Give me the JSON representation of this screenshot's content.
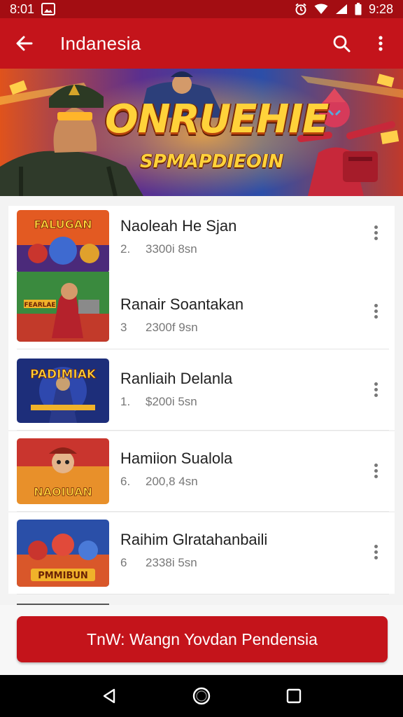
{
  "status_bar": {
    "left_time": "8:01",
    "right_time": "9:28",
    "icons": [
      "gallery-icon",
      "alarm-icon",
      "wifi-icon",
      "signal-icon",
      "battery-icon"
    ]
  },
  "app_bar": {
    "title": "Indanesia",
    "back_icon": "arrow-left-icon",
    "search_icon": "search-icon",
    "more_icon": "more-vertical-icon"
  },
  "banner": {
    "title": "ONRUEHIE",
    "subtitle": "SPMAPDIEOIN"
  },
  "list": {
    "items": [
      {
        "title": "Naoleah He Sjan",
        "number": "2.",
        "meta": "3300i 8sn",
        "thumb_text": "FALUGAN"
      },
      {
        "title": "Ranair Soantakan",
        "number": "3",
        "meta": "2300f 9sn",
        "thumb_text": "FEARLAE"
      },
      {
        "title": "Ranliaih Delanla",
        "number": "1.",
        "meta": "$200i 5sn",
        "thumb_text": "PADIMIAK"
      },
      {
        "title": "Hamiion Sualola",
        "number": "6.",
        "meta": "200,8 4sn",
        "thumb_text": "NAOIUAN"
      },
      {
        "title": "Raihim Glratahanbaili",
        "number": "6",
        "meta": "2338i 5sn",
        "thumb_text": "PMMIBUN"
      }
    ]
  },
  "cta": {
    "label": "TnW: Wangn Yovdan Pendensia"
  },
  "nav": {
    "back": "nav-back-icon",
    "home": "nav-home-icon",
    "recents": "nav-recents-icon"
  },
  "colors": {
    "primary": "#c4141b",
    "status": "#a30d12",
    "accent_gold": "#ffd23a"
  }
}
